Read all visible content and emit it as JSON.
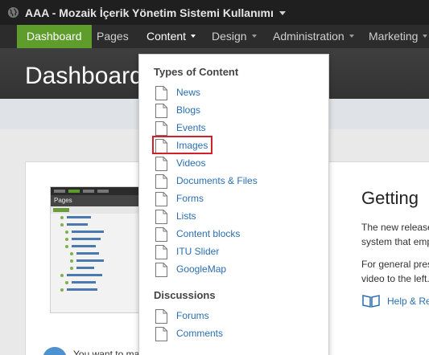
{
  "app": {
    "site_title": "AAA - Mozaik İçerik Yönetim Sistemi Kullanımı"
  },
  "nav": {
    "items": [
      {
        "label": "Dashboard",
        "active": true
      },
      {
        "label": "Pages"
      },
      {
        "label": "Content",
        "open": true
      },
      {
        "label": "Design"
      },
      {
        "label": "Administration"
      },
      {
        "label": "Marketing"
      }
    ]
  },
  "header": {
    "page_title": "Dashboard"
  },
  "main": {
    "thumbnail": {
      "title": "Pages"
    },
    "getting_title": "Getting",
    "para1_line1": "The new release",
    "para1_line2": "system that emp",
    "para2_line1": "For general pres",
    "para2_line2": "video to the left.",
    "help_link": "Help & Re",
    "bottom_text": "You want to ma"
  },
  "dropdown": {
    "types_heading": "Types of Content",
    "types": [
      "News",
      "Blogs",
      "Events",
      "Images",
      "Videos",
      "Documents & Files",
      "Forms",
      "Lists",
      "Content blocks",
      "ITU Slider",
      "GoogleMap"
    ],
    "highlighted": "Images",
    "discussions_heading": "Discussions",
    "discussions": [
      "Forums",
      "Comments"
    ]
  },
  "colors": {
    "accent_green": "#5e9c2c",
    "link_blue": "#2a6eb1",
    "highlight_red": "#d0202a"
  }
}
